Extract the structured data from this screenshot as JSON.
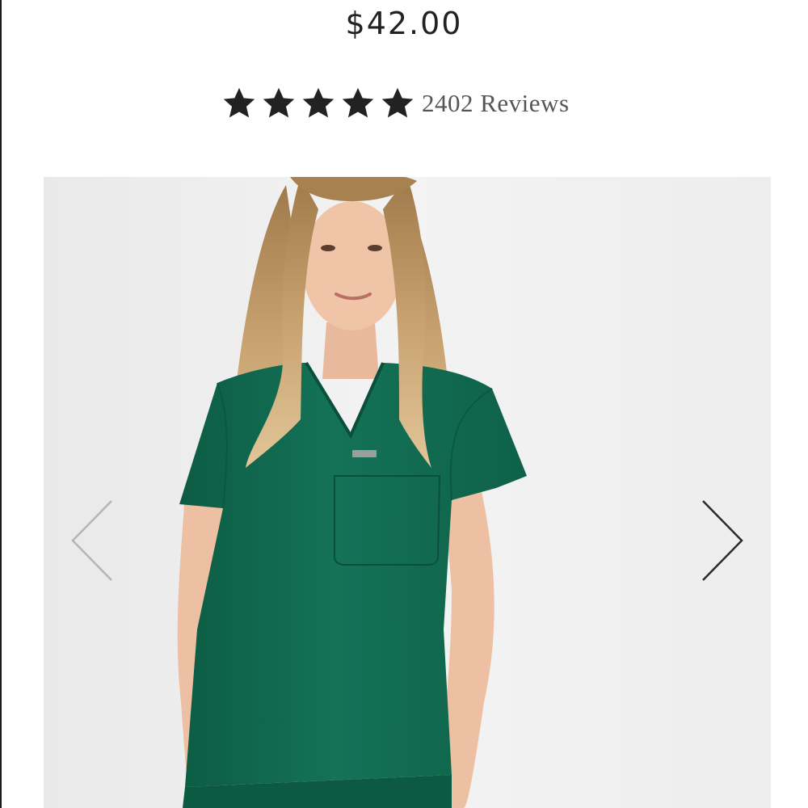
{
  "product": {
    "price": "$42.00",
    "rating": {
      "stars": 5,
      "max_stars": 5,
      "reviews_label": "2402 Reviews"
    }
  },
  "gallery": {
    "image_alt": "Model wearing green short-sleeve V-neck scrub top with chest pocket",
    "prev_icon": "chevron-left-icon",
    "next_icon": "chevron-right-icon"
  },
  "colors": {
    "scrub_green": "#0f6b4e",
    "star": "#222222",
    "price_text": "#222222",
    "review_text": "#555555",
    "gallery_bg": "#efefef"
  }
}
